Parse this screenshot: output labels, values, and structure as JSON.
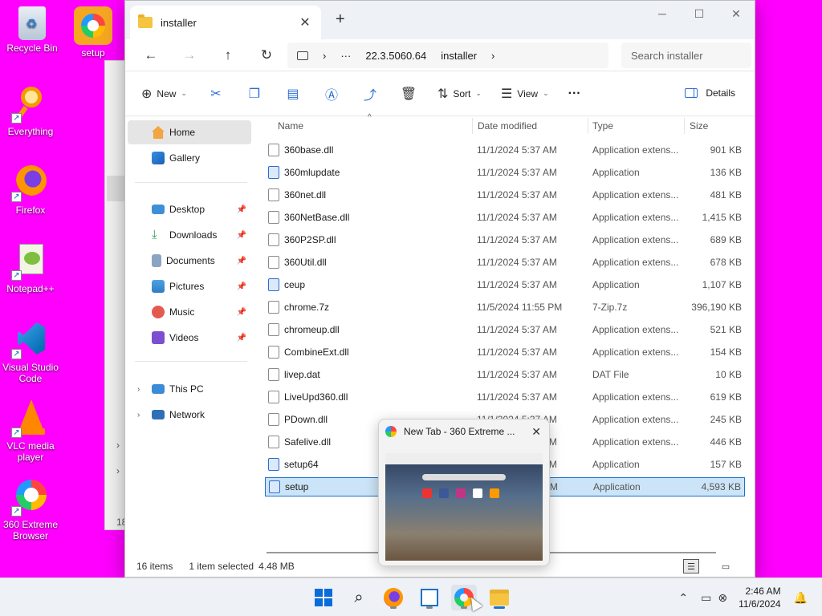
{
  "desktop": {
    "icons": [
      {
        "label": "Recycle Bin",
        "icon": "recycle-bin-icon"
      },
      {
        "label": "setup",
        "icon": "setup-icon"
      },
      {
        "label": "Everything",
        "icon": "everything-icon"
      },
      {
        "label": "Firefox",
        "icon": "firefox-icon"
      },
      {
        "label": "Notepad++",
        "icon": "notepad-icon"
      },
      {
        "label": "Visual Studio Code",
        "icon": "vscode-icon"
      },
      {
        "label": "VLC media player",
        "icon": "vlc-icon"
      },
      {
        "label": "360 Extreme Browser",
        "icon": "360-browser-icon"
      }
    ],
    "bg_text": "18"
  },
  "explorer": {
    "tab_title": "installer",
    "newtab": "+",
    "controls": {
      "minimize": "─",
      "maximize": "☐",
      "close": "✕"
    },
    "nav": {
      "back": "←",
      "forward": "→",
      "up": "↑",
      "refresh": "↻"
    },
    "breadcrumb": {
      "more": "···",
      "path1": "22.3.5060.64",
      "path2": "installer",
      "sep": "›"
    },
    "search_placeholder": "Search installer",
    "commands": {
      "new": "New",
      "sort": "Sort",
      "view": "View",
      "more": "···",
      "details": "Details"
    },
    "sidebar": {
      "home": "Home",
      "gallery": "Gallery",
      "desktop": "Desktop",
      "downloads": "Downloads",
      "documents": "Documents",
      "pictures": "Pictures",
      "music": "Music",
      "videos": "Videos",
      "this_pc": "This PC",
      "network": "Network"
    },
    "columns": {
      "name": "Name",
      "date": "Date modified",
      "type": "Type",
      "size": "Size"
    },
    "files": [
      {
        "name": "360base.dll",
        "date": "11/1/2024 5:37 AM",
        "type": "Application extens...",
        "size": "901 KB"
      },
      {
        "name": "360mlupdate",
        "date": "11/1/2024 5:37 AM",
        "type": "Application",
        "size": "136 KB"
      },
      {
        "name": "360net.dll",
        "date": "11/1/2024 5:37 AM",
        "type": "Application extens...",
        "size": "481 KB"
      },
      {
        "name": "360NetBase.dll",
        "date": "11/1/2024 5:37 AM",
        "type": "Application extens...",
        "size": "1,415 KB"
      },
      {
        "name": "360P2SP.dll",
        "date": "11/1/2024 5:37 AM",
        "type": "Application extens...",
        "size": "689 KB"
      },
      {
        "name": "360Util.dll",
        "date": "11/1/2024 5:37 AM",
        "type": "Application extens...",
        "size": "678 KB"
      },
      {
        "name": "ceup",
        "date": "11/1/2024 5:37 AM",
        "type": "Application",
        "size": "1,107 KB"
      },
      {
        "name": "chrome.7z",
        "date": "11/5/2024 11:55 PM",
        "type": "7-Zip.7z",
        "size": "396,190 KB"
      },
      {
        "name": "chromeup.dll",
        "date": "11/1/2024 5:37 AM",
        "type": "Application extens...",
        "size": "521 KB"
      },
      {
        "name": "CombineExt.dll",
        "date": "11/1/2024 5:37 AM",
        "type": "Application extens...",
        "size": "154 KB"
      },
      {
        "name": "livep.dat",
        "date": "11/1/2024 5:37 AM",
        "type": "DAT File",
        "size": "10 KB"
      },
      {
        "name": "LiveUpd360.dll",
        "date": "11/1/2024 5:37 AM",
        "type": "Application extens...",
        "size": "619 KB"
      },
      {
        "name": "PDown.dll",
        "date": "11/1/2024 5:37 AM",
        "type": "Application extens...",
        "size": "245 KB"
      },
      {
        "name": "Safelive.dll",
        "date": "11/1/2024 5:37 AM",
        "type": "Application extens...",
        "size": "446 KB"
      },
      {
        "name": "setup64",
        "date": "11/1/2024 5:37 AM",
        "type": "Application",
        "size": "157 KB"
      },
      {
        "name": "setup",
        "date": "11/1/2024 5:37 AM",
        "type": "Application",
        "size": "4,593 KB"
      }
    ],
    "status": {
      "items": "16 items",
      "selected": "1 item selected",
      "sel_size": "4.48 MB"
    }
  },
  "thumbnail": {
    "title": "New Tab - 360 Extreme ...",
    "close": "✕"
  },
  "taskbar": {
    "time": "2:46 AM",
    "date": "11/6/2024",
    "apps": [
      "start-icon",
      "search-icon",
      "firefox-icon",
      "notepad-icon",
      "360-browser-icon",
      "file-explorer-icon"
    ]
  },
  "colors": {
    "desktop": "#ff00ff",
    "selection": "#cce4f7",
    "accent": "#1a73c8"
  }
}
